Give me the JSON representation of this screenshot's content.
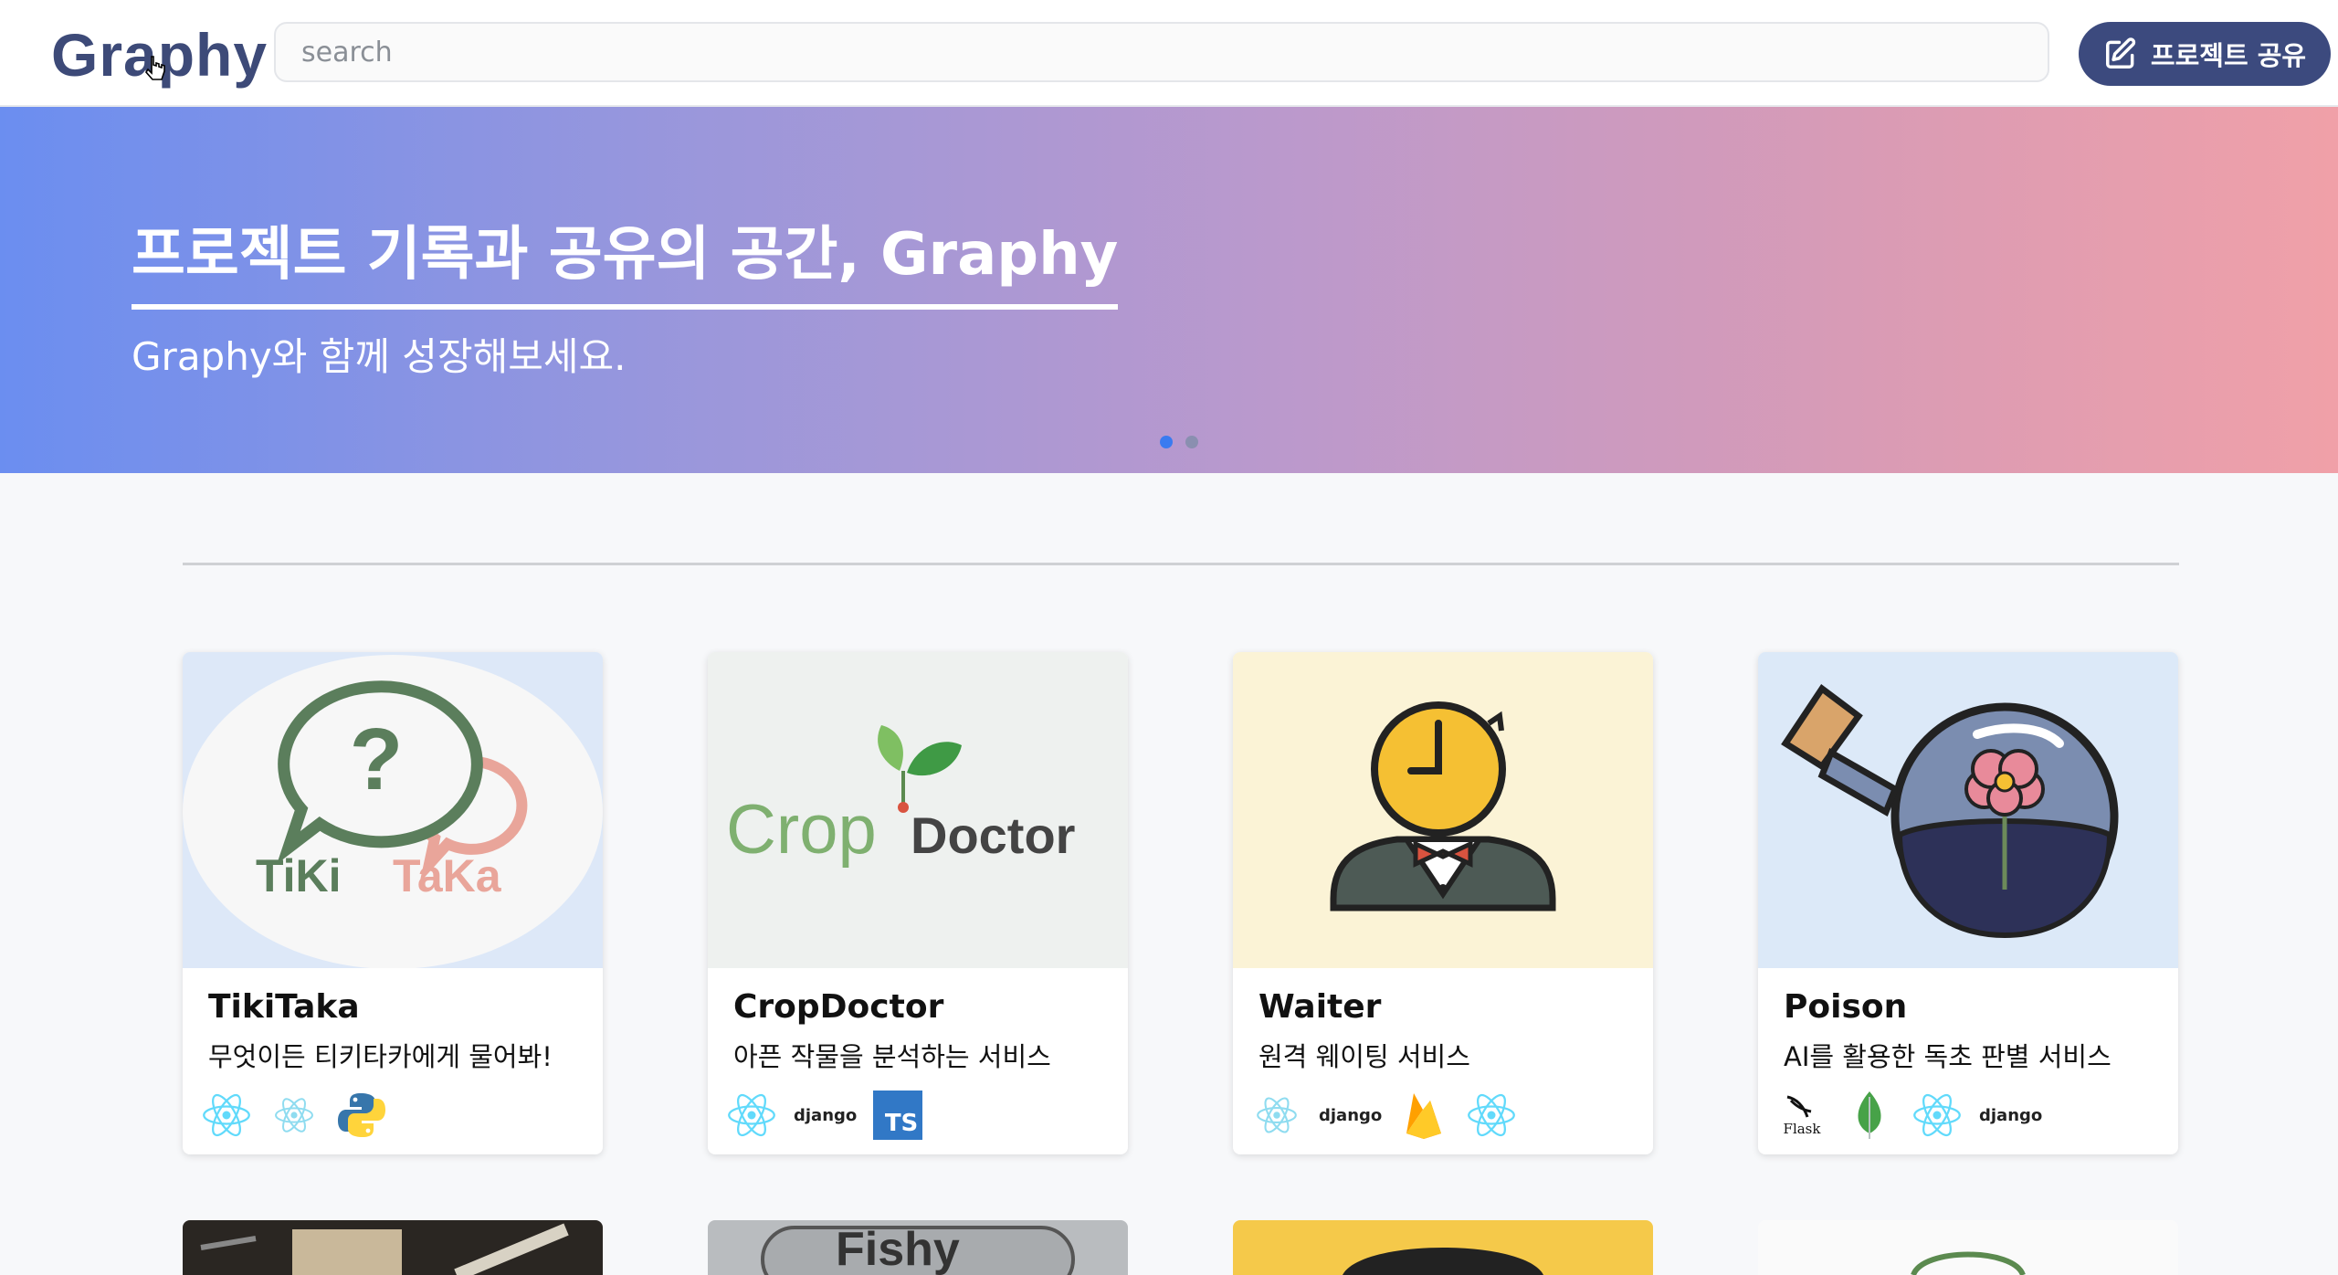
{
  "header": {
    "logo": "Graphy",
    "search_placeholder": "search",
    "share_label": "프로젝트 공유"
  },
  "banner": {
    "title": "프로젝트 기록과 공유의 공간, Graphy",
    "subtitle": "Graphy와 함께 성장해보세요.",
    "slides": 2,
    "active_slide": 1
  },
  "projects": [
    {
      "name": "TikiTaka",
      "desc": "무엇이든 티키타카에게 물어봐!",
      "logo_text": [
        "TiKi",
        "TaKa"
      ],
      "stack": [
        "react-icon",
        "react-native-icon",
        "python-icon"
      ]
    },
    {
      "name": "CropDoctor",
      "desc": "아픈 작물을 분석하는 서비스",
      "logo_text": [
        "Crop",
        "Doctor"
      ],
      "stack": [
        "react-icon",
        "django",
        "TS"
      ]
    },
    {
      "name": "Waiter",
      "desc": "원격 웨이팅 서비스",
      "stack": [
        "react-native-icon",
        "django",
        "firebase-icon",
        "react-icon"
      ]
    },
    {
      "name": "Poison",
      "desc": "AI를 활용한 독초 판별 서비스",
      "stack": [
        "Flask",
        "mongodb-icon",
        "react-icon",
        "django"
      ]
    }
  ],
  "peek_cards": [
    {
      "text": ""
    },
    {
      "text": "Fishy"
    },
    {
      "text": ""
    },
    {
      "text": ""
    }
  ],
  "colors": {
    "brand": "#3c4a7e",
    "react": "#61dafb",
    "typescript": "#3178c6",
    "dot_active": "#3a7bf0"
  }
}
